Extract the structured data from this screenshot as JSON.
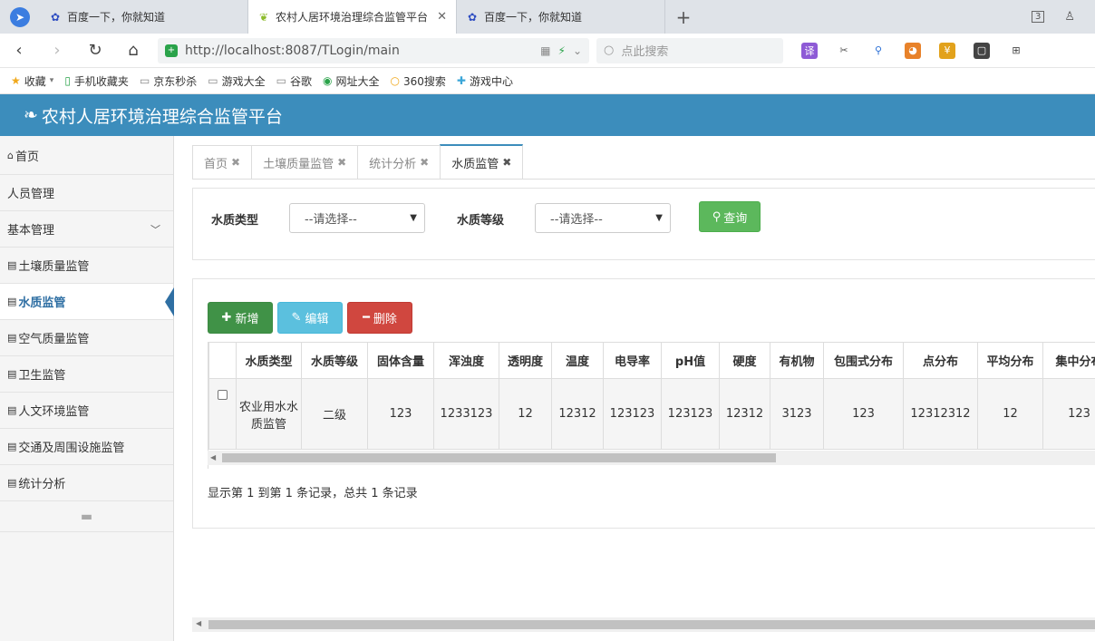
{
  "browser": {
    "tabs": [
      {
        "title": "百度一下，你就知道",
        "icon": "paw-icon",
        "active": false
      },
      {
        "title": "农村人居环境治理综合监管平台",
        "icon": "leaf-icon",
        "active": true
      },
      {
        "title": "百度一下，你就知道",
        "icon": "paw-icon",
        "active": false
      }
    ],
    "tab_count": "3",
    "url": "http://localhost:8087/TLogin/main",
    "search_placeholder": "点此搜索"
  },
  "bookmarks": [
    {
      "label": "收藏",
      "icon": "star-icon"
    },
    {
      "label": "手机收藏夹",
      "icon": "phone-icon"
    },
    {
      "label": "京东秒杀",
      "icon": "page-icon"
    },
    {
      "label": "游戏大全",
      "icon": "page-icon"
    },
    {
      "label": "谷歌",
      "icon": "page-icon"
    },
    {
      "label": "网址大全",
      "icon": "globe-icon"
    },
    {
      "label": "360搜索",
      "icon": "search-icon"
    },
    {
      "label": "游戏中心",
      "icon": "gamepad-icon"
    }
  ],
  "app": {
    "title": "农村人居环境治理综合监管平台"
  },
  "sidebar": {
    "items": [
      {
        "label": "首页",
        "icon": "home-icon"
      },
      {
        "label": "人员管理",
        "icon": ""
      },
      {
        "label": "基本管理",
        "icon": ""
      },
      {
        "label": "土壤质量监管",
        "icon": "panel-icon"
      },
      {
        "label": "水质监管",
        "icon": "panel-icon"
      },
      {
        "label": "空气质量监管",
        "icon": "panel-icon"
      },
      {
        "label": "卫生监管",
        "icon": "panel-icon"
      },
      {
        "label": "人文环境监管",
        "icon": "panel-icon"
      },
      {
        "label": "交通及周围设施监管",
        "icon": "panel-icon"
      },
      {
        "label": "统计分析",
        "icon": "panel-icon"
      }
    ]
  },
  "content_tabs": [
    {
      "label": "首页"
    },
    {
      "label": "土壤质量监管"
    },
    {
      "label": "统计分析"
    },
    {
      "label": "水质监管"
    }
  ],
  "filter": {
    "type_label": "水质类型",
    "type_value": "--请选择--",
    "level_label": "水质等级",
    "level_value": "--请选择--",
    "query_label": "查询"
  },
  "toolbar": {
    "add_label": "新增",
    "edit_label": "编辑",
    "delete_label": "删除"
  },
  "table": {
    "columns": [
      "水质类型",
      "水质等级",
      "固体含量",
      "浑浊度",
      "透明度",
      "温度",
      "电导率",
      "pH值",
      "硬度",
      "有机物",
      "包围式分布",
      "点分布",
      "平均分布",
      "集中分布"
    ],
    "rows": [
      [
        "农业用水水质监管",
        "二级",
        "123",
        "1233123",
        "12",
        "12312",
        "123123",
        "123123",
        "12312",
        "3123",
        "123",
        "12312312",
        "12",
        "123"
      ]
    ]
  },
  "pagination": {
    "summary": "显示第 1 到第 1 条记录，总共 1 条记录"
  }
}
